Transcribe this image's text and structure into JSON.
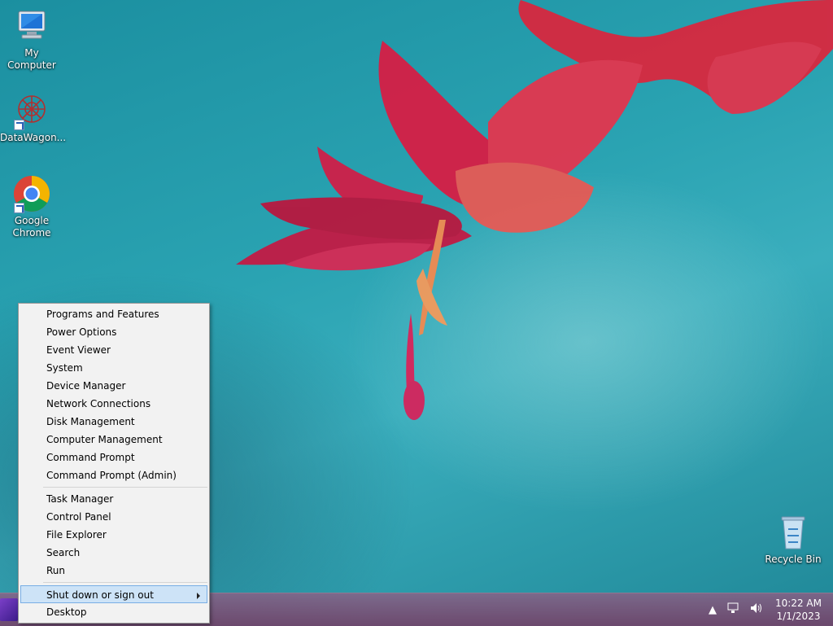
{
  "desktop": {
    "icons": [
      {
        "label": "My Computer",
        "icon": "computer-icon"
      },
      {
        "label": "DataWagon...",
        "icon": "datawagon-icon"
      },
      {
        "label": "Google\nChrome",
        "icon": "chrome-icon"
      },
      {
        "label": "Recycle Bin",
        "icon": "recycle-bin-icon"
      }
    ]
  },
  "context_menu": {
    "group1": [
      "Programs and Features",
      "Power Options",
      "Event Viewer",
      "System",
      "Device Manager",
      "Network Connections",
      "Disk Management",
      "Computer Management",
      "Command Prompt",
      "Command Prompt (Admin)"
    ],
    "group2": [
      "Task Manager",
      "Control Panel",
      "File Explorer",
      "Search",
      "Run"
    ],
    "group3": [
      "Shut down or sign out",
      "Desktop"
    ],
    "selected": "Shut down or sign out"
  },
  "taskbar": {
    "clock_time": "10:22 AM",
    "clock_date": "1/1/2023"
  },
  "colors": {
    "menu_bg": "#f2f2f2",
    "menu_highlight": "#cde3f7",
    "taskbar": "#8a4a7a",
    "desktop": "#2aa3b2"
  }
}
